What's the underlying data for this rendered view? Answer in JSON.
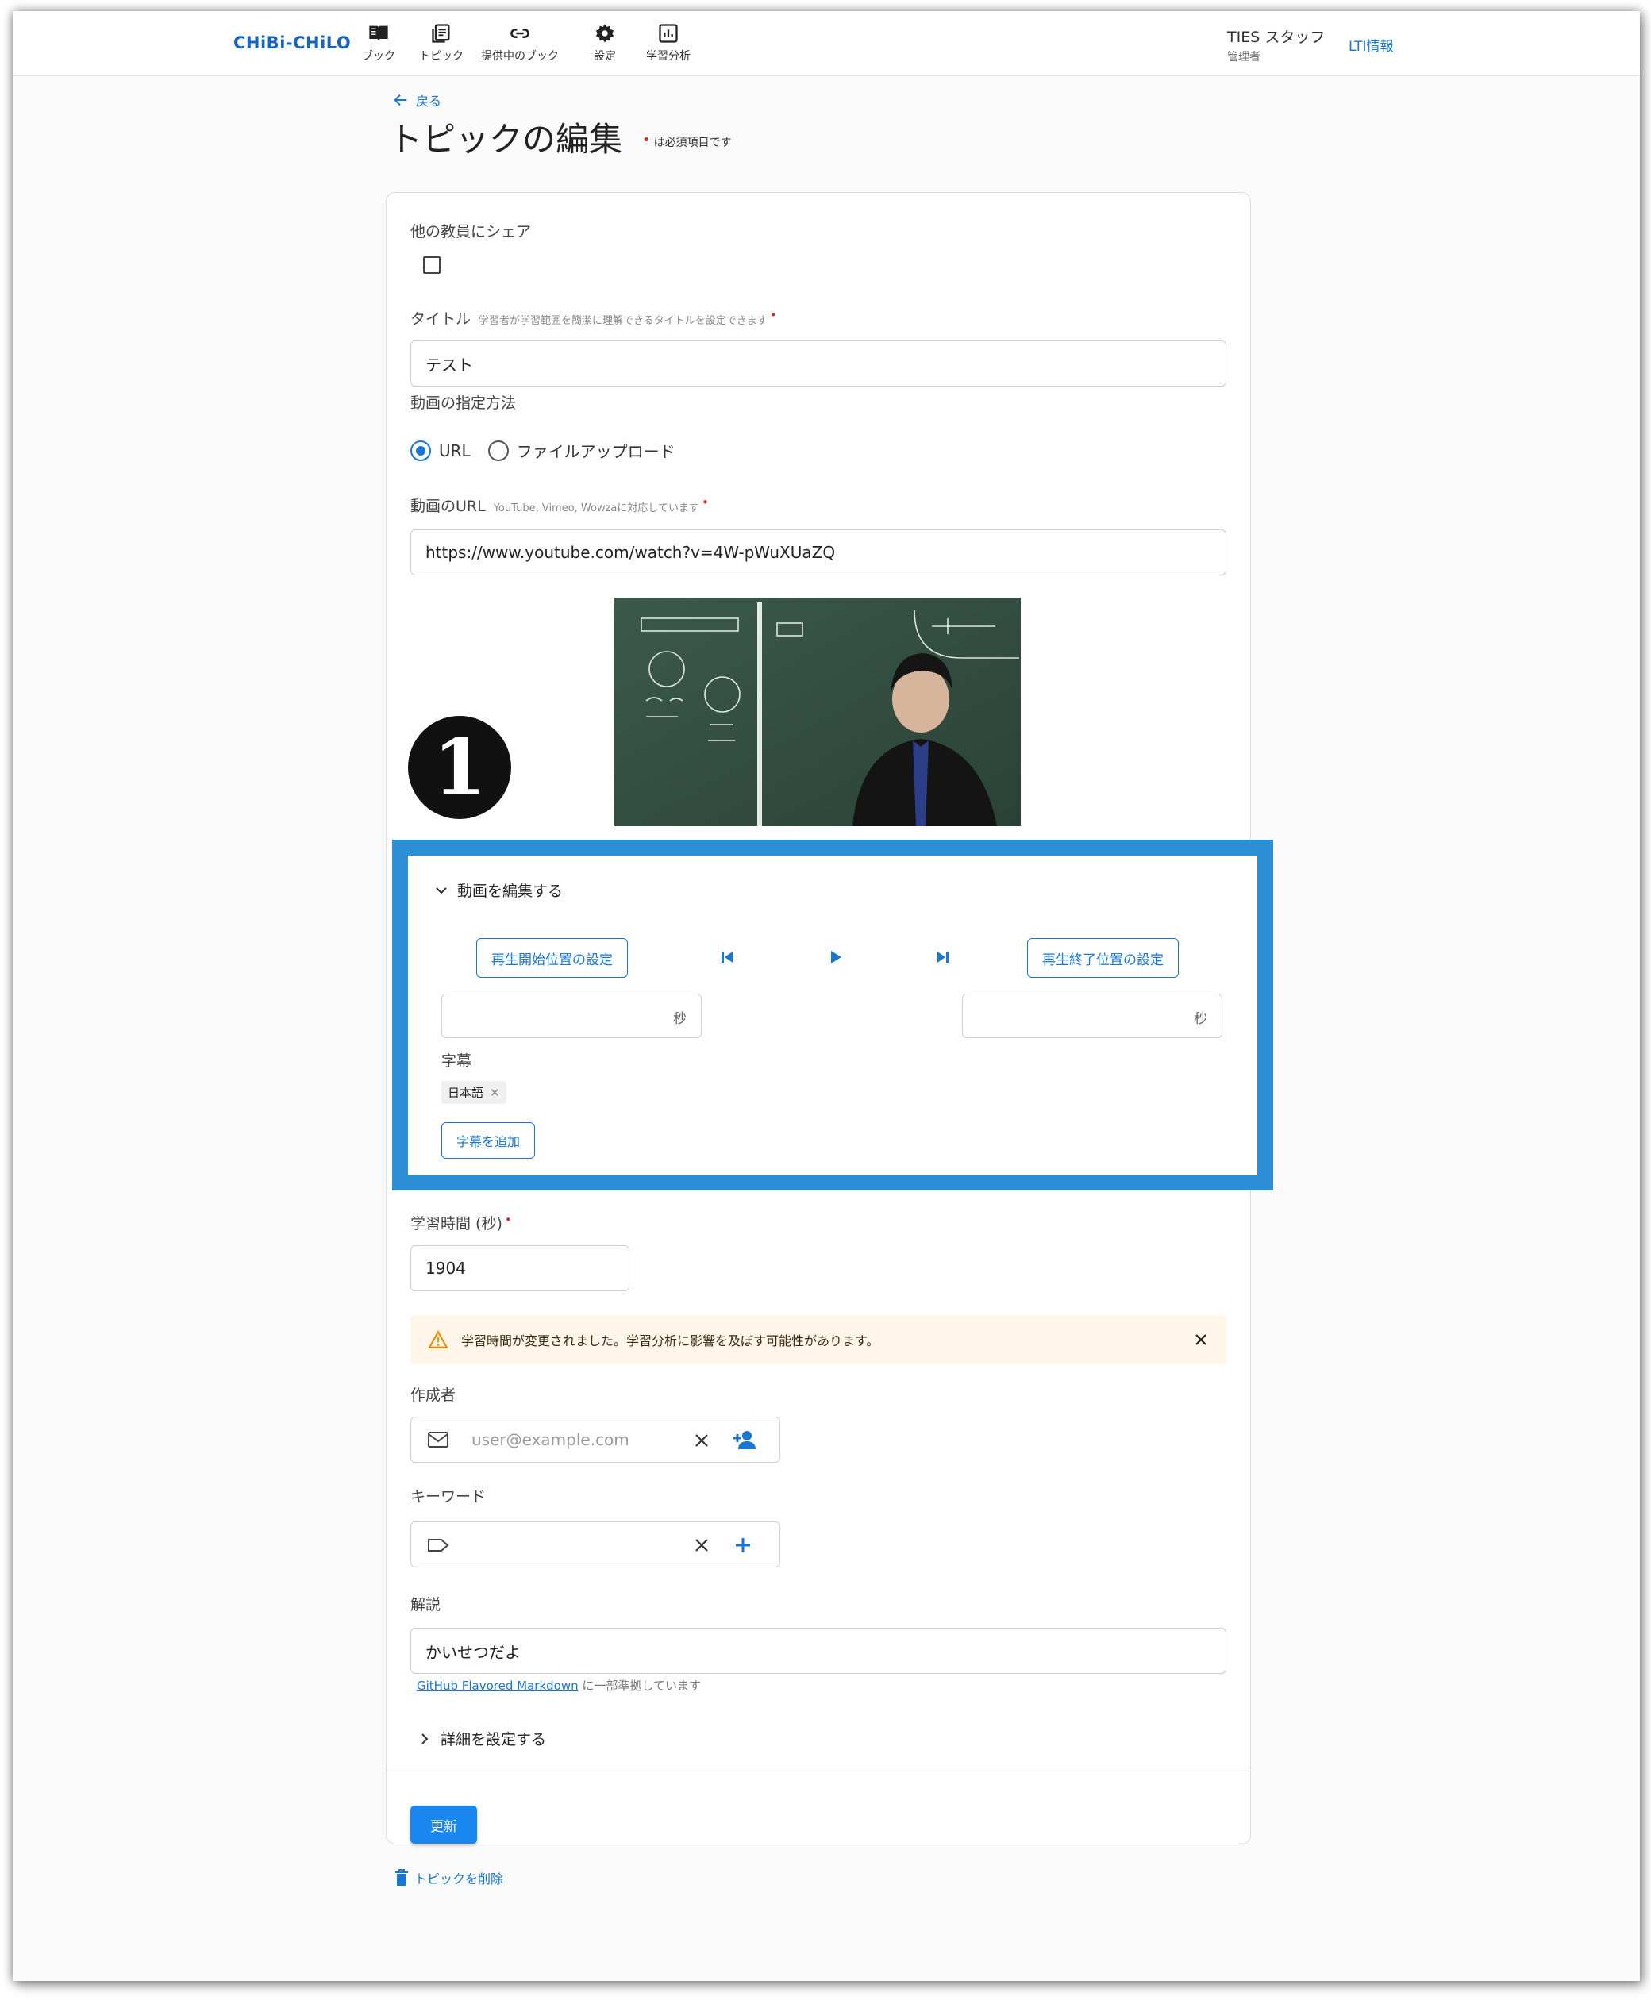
{
  "app": {
    "logo": "CHiBi-CHiLO",
    "nav": [
      {
        "label": "ブック",
        "icon": "book-icon"
      },
      {
        "label": "トピック",
        "icon": "topic-icon"
      },
      {
        "label": "提供中のブック",
        "icon": "link-icon"
      },
      {
        "label": "設定",
        "icon": "gear-icon"
      },
      {
        "label": "学習分析",
        "icon": "analytics-icon"
      }
    ],
    "user_name": "TIES スタッフ",
    "user_role": "管理者",
    "lti_link": "LTI情報"
  },
  "page": {
    "back_label": "戻る",
    "title": "トピックの編集",
    "required_note": "は必須項目です"
  },
  "form": {
    "share_label": "他の教員にシェア",
    "share_checked": false,
    "title_label": "タイトル",
    "title_hint": "学習者が学習範囲を簡潔に理解できるタイトルを設定できます",
    "title_value": "テスト",
    "video_method_label": "動画の指定方法",
    "video_method_options": [
      "URL",
      "ファイルアップロード"
    ],
    "video_method_selected": "URL",
    "video_url_label": "動画のURL",
    "video_url_hint": "YouTube, Vimeo, Wowzaに対応しています",
    "video_url_value": "https://www.youtube.com/watch?v=4W-pWuXUaZQ"
  },
  "annotation": {
    "badge": "1",
    "highlight_color": "#2c8fd6"
  },
  "editor": {
    "toggle_label": "動画を編集する",
    "start_button": "再生開始位置の設定",
    "end_button": "再生終了位置の設定",
    "start_value": "",
    "end_value": "",
    "seconds_unit": "秒",
    "subtitle_label": "字幕",
    "subtitle_chip": "日本語",
    "add_subtitle_button": "字幕を追加"
  },
  "learning": {
    "time_label": "学習時間 (秒)",
    "time_value": "1904",
    "warning": "学習時間が変更されました。学習分析に影響を及ぼす可能性があります。"
  },
  "author": {
    "label": "作成者",
    "placeholder": "user@example.com"
  },
  "keyword": {
    "label": "キーワード",
    "value": ""
  },
  "commentary": {
    "label": "解説",
    "value": "かいせつだよ",
    "markdown_link": "GitHub Flavored Markdown",
    "markdown_note": "に一部準拠しています"
  },
  "details_label": "詳細を設定する",
  "update_button": "更新",
  "delete_label": "トピックを削除",
  "colors": {
    "accent": "#1976d2",
    "required": "#d32f2f",
    "warning_bg": "#fff5e8",
    "primary_button": "#1a86f0"
  }
}
